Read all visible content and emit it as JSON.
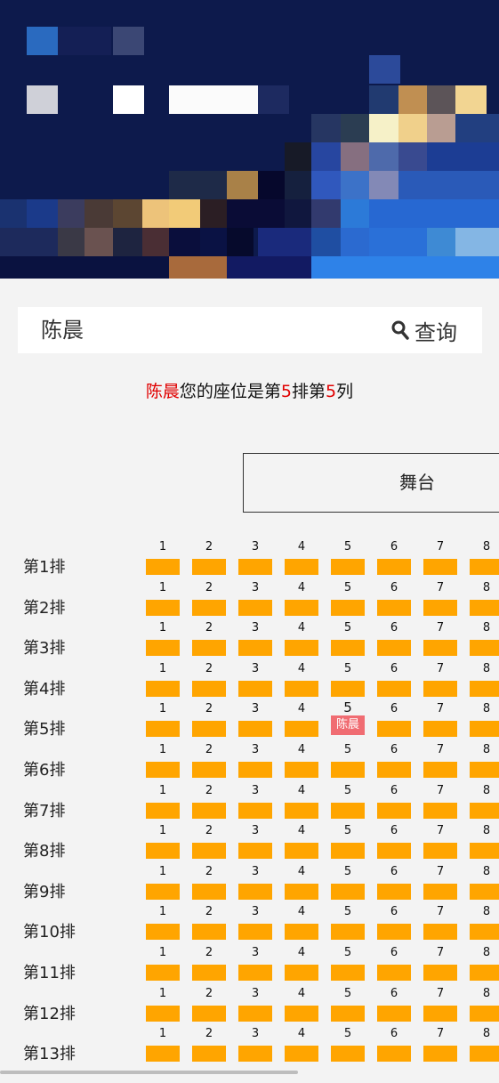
{
  "search": {
    "name": "陈晨",
    "button_label": "查询"
  },
  "result": {
    "name": "陈晨",
    "t1": "您的座位是第",
    "row": "5",
    "t2": "排第",
    "col": "5",
    "t3": "列"
  },
  "stage": {
    "label": "舞台"
  },
  "seating": {
    "rows": [
      "第1排",
      "第2排",
      "第3排",
      "第4排",
      "第5排",
      "第6排",
      "第7排",
      "第8排",
      "第9排",
      "第10排",
      "第11排",
      "第12排",
      "第13排"
    ],
    "columns": [
      "1",
      "2",
      "3",
      "4",
      "5",
      "6",
      "7",
      "8"
    ],
    "highlight": {
      "row_index": 4,
      "col_index": 4,
      "label": "陈晨"
    }
  },
  "colors": {
    "seat": "#ffa500",
    "highlight_seat": "#f06c72",
    "accent": "#e00000"
  }
}
